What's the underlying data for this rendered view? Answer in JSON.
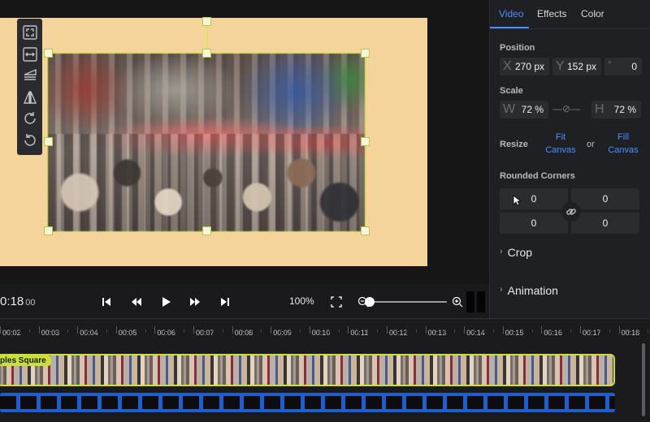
{
  "player": {
    "time": "0:18",
    "frames": "00",
    "zoom": "100%",
    "zoom_slider_level": 0.0
  },
  "panel": {
    "tabs": [
      "Video",
      "Effects",
      "Color"
    ],
    "active_tab": "Video",
    "position": {
      "label": "Position",
      "x_prefix": "X",
      "x": "270 px",
      "y_prefix": "Y",
      "y": "152 px",
      "rot_prefix": "°",
      "rotation": "0"
    },
    "scale": {
      "label": "Scale",
      "w_prefix": "W",
      "w": "72 %",
      "h_prefix": "H",
      "h": "72 %"
    },
    "resize": {
      "label": "Resize",
      "fit": "Fit Canvas",
      "or": "or",
      "fill": "Fill Canvas"
    },
    "corners": {
      "label": "Rounded Corners",
      "values": [
        "0",
        "0",
        "0",
        "0"
      ]
    },
    "crop": "Crop",
    "animation": "Animation"
  },
  "timeline": {
    "ticks": [
      "00:02",
      "00:03",
      "00:04",
      "00:05",
      "00:06",
      "00:07",
      "00:08",
      "00:09",
      "00:10",
      "00:11",
      "00:12",
      "00:13",
      "00:14",
      "00:15",
      "00:16",
      "00:17",
      "00:18"
    ],
    "clip_label": "ples Square"
  },
  "colors": {
    "accent": "#4a8eff",
    "selection": "#c9e03c",
    "canvas": "#f5d49c",
    "audio_track": "#1e5fd0"
  }
}
